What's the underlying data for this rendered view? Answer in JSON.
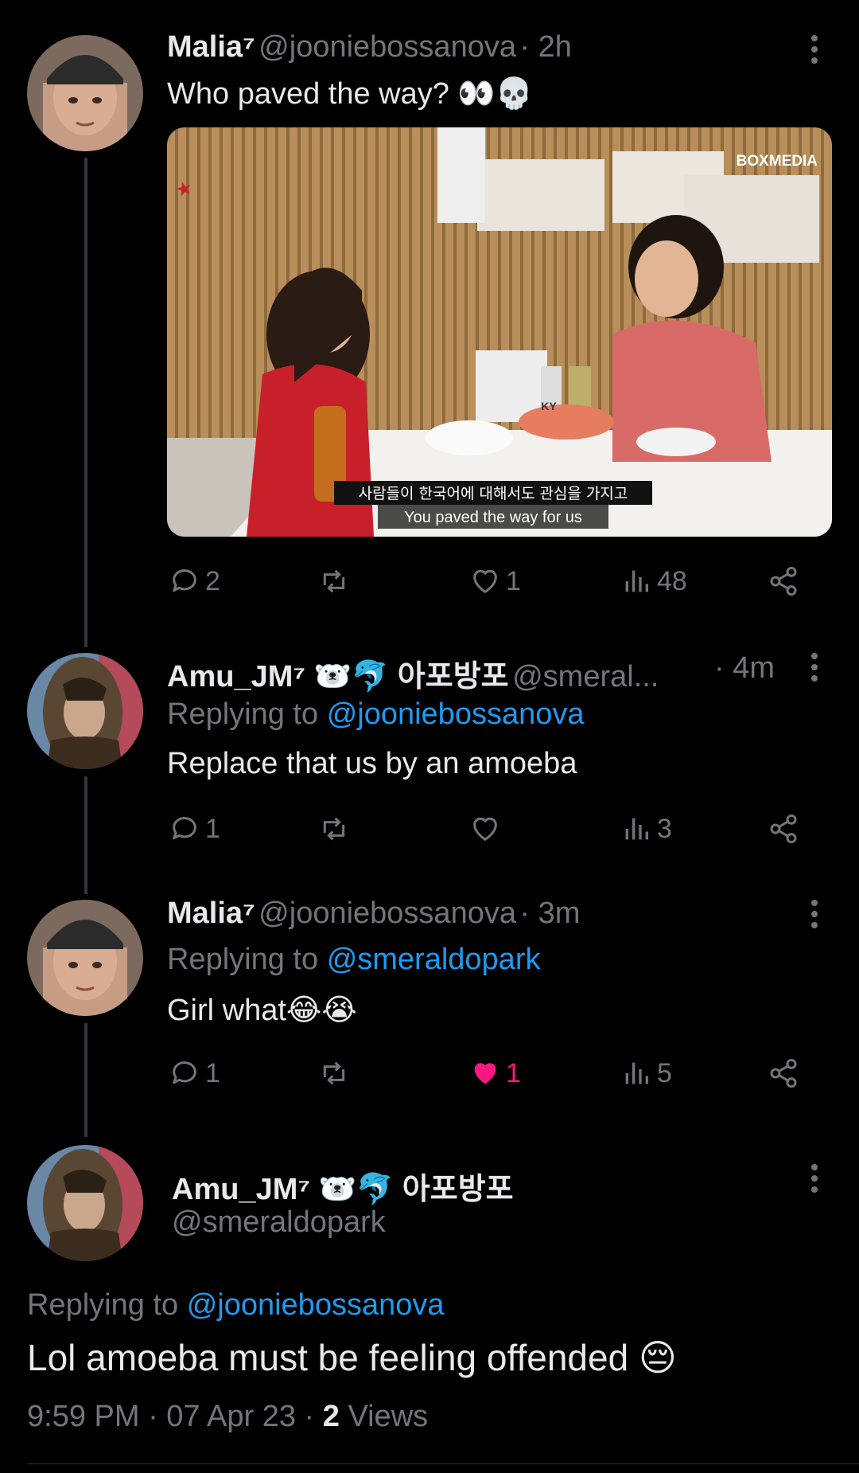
{
  "tweets": [
    {
      "name": "Malia⁷",
      "handle": "@jooniebossanova",
      "time": "· 2h",
      "text": "Who paved the way? 👀💀",
      "media": {
        "corner_logo": "BOXMEDIA",
        "bottle_label": "KY",
        "subtitle_korean": "사람들이 한국어에 대해서도 관심을 가지고",
        "subtitle_english": "You paved the way for us"
      },
      "actions": {
        "replies": "2",
        "retweets": "",
        "likes": "1",
        "views": "48"
      }
    },
    {
      "name": "Amu_JM⁷ 🐻‍❄️🐬 아포방포",
      "handle": "@smeral...",
      "time": "· 4m",
      "replying_prefix": "Replying to",
      "replying_to": "@jooniebossanova",
      "text": "Replace that us by an amoeba",
      "actions": {
        "replies": "1",
        "retweets": "",
        "likes": "",
        "views": "3"
      }
    },
    {
      "name": "Malia⁷",
      "handle": "@jooniebossanova",
      "time": "· 3m",
      "replying_prefix": "Replying to",
      "replying_to": "@smeraldopark",
      "text": "Girl what😂😭",
      "actions": {
        "replies": "1",
        "retweets": "",
        "likes": "1",
        "views": "5"
      }
    }
  ],
  "focused": {
    "name": "Amu_JM⁷ 🐻‍❄️🐬 아포방포",
    "handle": "@smeraldopark",
    "replying_prefix": "Replying to",
    "replying_to": "@jooniebossanova",
    "text": "Lol amoeba must be feeling offended 😔",
    "time": "9:59 PM · 07 Apr 23 ·",
    "views_count": "2",
    "views_label": "Views"
  },
  "colors": {
    "like_active": "#f91880",
    "mention": "#1d9bf0",
    "muted": "#71767b"
  }
}
